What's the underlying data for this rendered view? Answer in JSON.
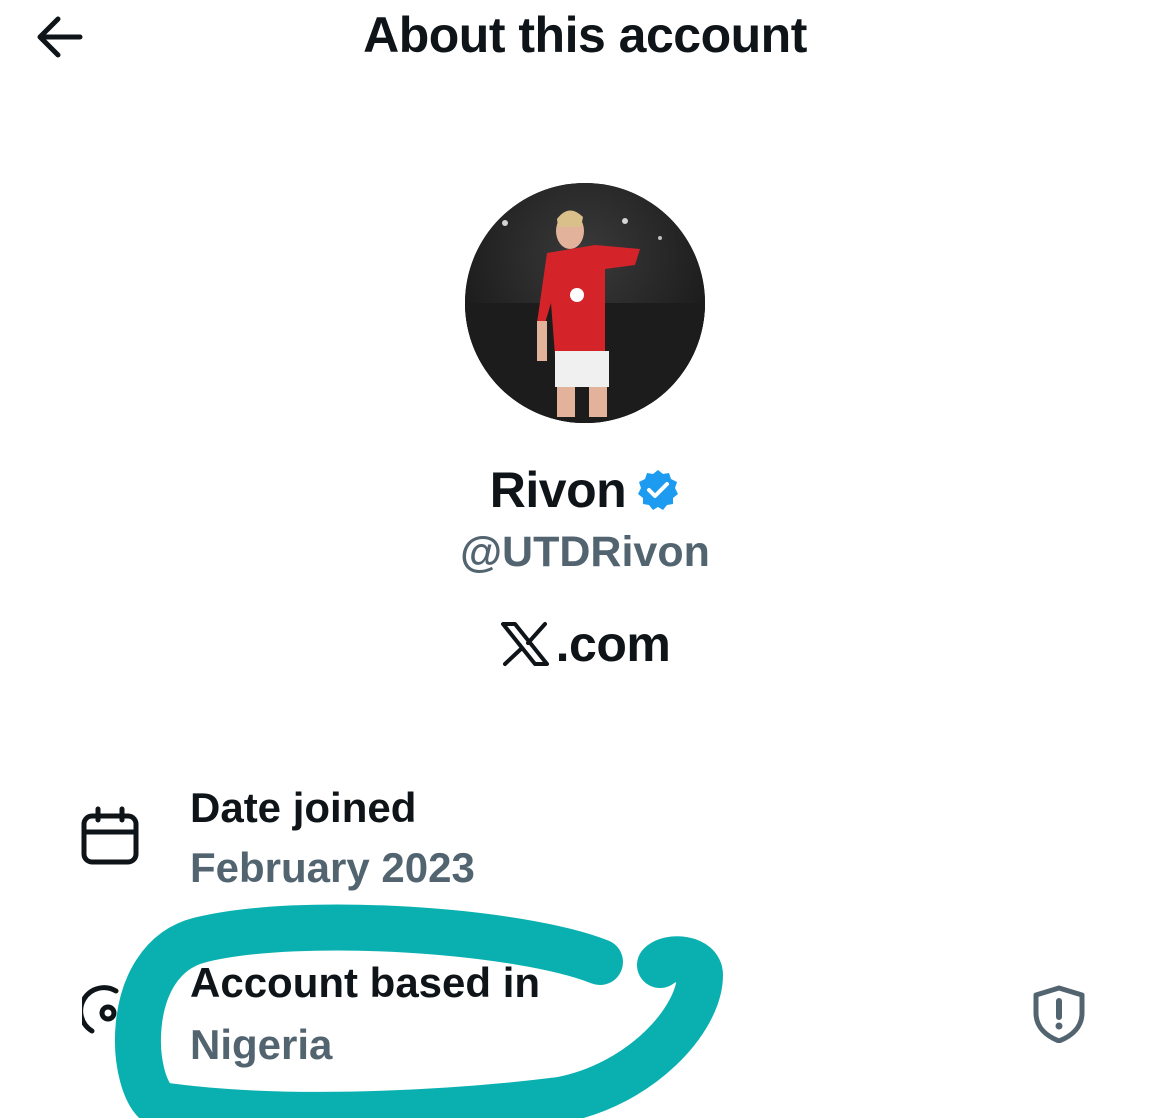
{
  "header": {
    "title": "About this account",
    "back_icon": "arrow-left-icon"
  },
  "profile": {
    "avatar_description": "profile-photo",
    "display_name": "Rivon",
    "verified_icon": "verified-badge-icon",
    "verified_color": "#1d9bf0",
    "handle": "@UTDRivon",
    "domain_suffix": ".com",
    "domain_logo_icon": "x-logo-icon"
  },
  "details": [
    {
      "icon": "calendar-icon",
      "label": "Date joined",
      "value": "February 2023"
    },
    {
      "icon": "location-icon",
      "label": "Account based in",
      "value": "Nigeria",
      "trailing_icon": "shield-alert-icon"
    }
  ],
  "colors": {
    "text_primary": "#0f1419",
    "text_secondary": "#536471",
    "annotation_stroke": "#0ab0b0"
  }
}
